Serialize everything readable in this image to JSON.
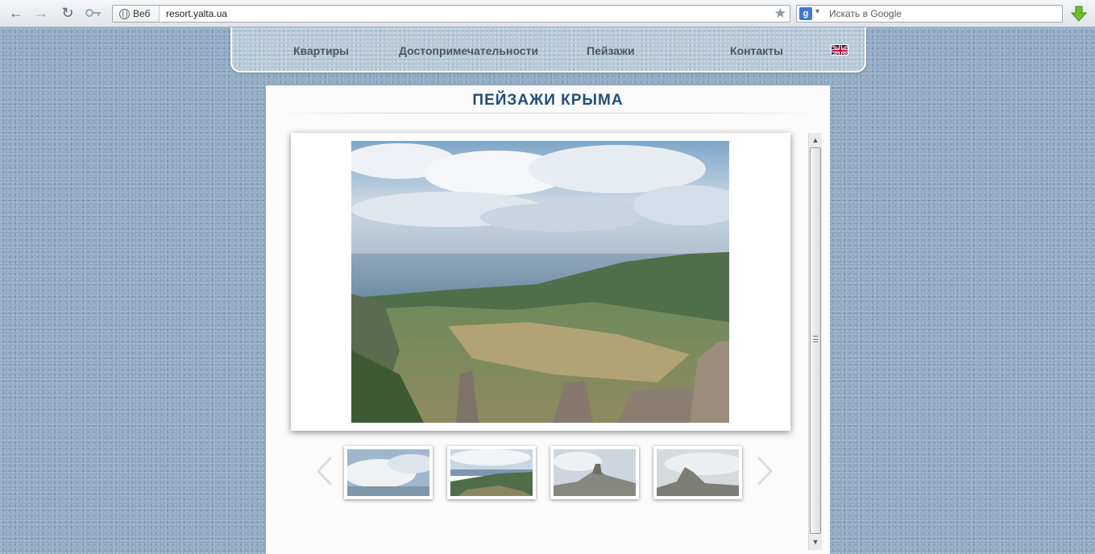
{
  "browser": {
    "omnibox_chip": "Веб",
    "url": "resort.yalta.ua",
    "search_placeholder": "Искать в Google",
    "search_engine_badge": "g"
  },
  "site_nav": {
    "items": [
      {
        "label": "Квартиры"
      },
      {
        "label": "Достопримечательности"
      },
      {
        "label": "Пейзажи"
      },
      {
        "label": "Контакты"
      }
    ],
    "language_flag": "uk-flag-icon"
  },
  "page": {
    "title": "ПЕЙЗАЖИ КРЫМА"
  },
  "gallery": {
    "main_image": "crimean-mountain-landscape",
    "thumbnails": [
      {
        "image": "cloudy-sky-sea"
      },
      {
        "image": "valley-mountains-selected"
      },
      {
        "image": "rock-pillars"
      },
      {
        "image": "misty-mountain"
      }
    ],
    "prev_icon": "chevron-left-icon",
    "next_icon": "chevron-right-icon"
  },
  "colors": {
    "title": "#214e7a",
    "nav_text": "#4d5560",
    "page_background": "#8fa9c2"
  }
}
